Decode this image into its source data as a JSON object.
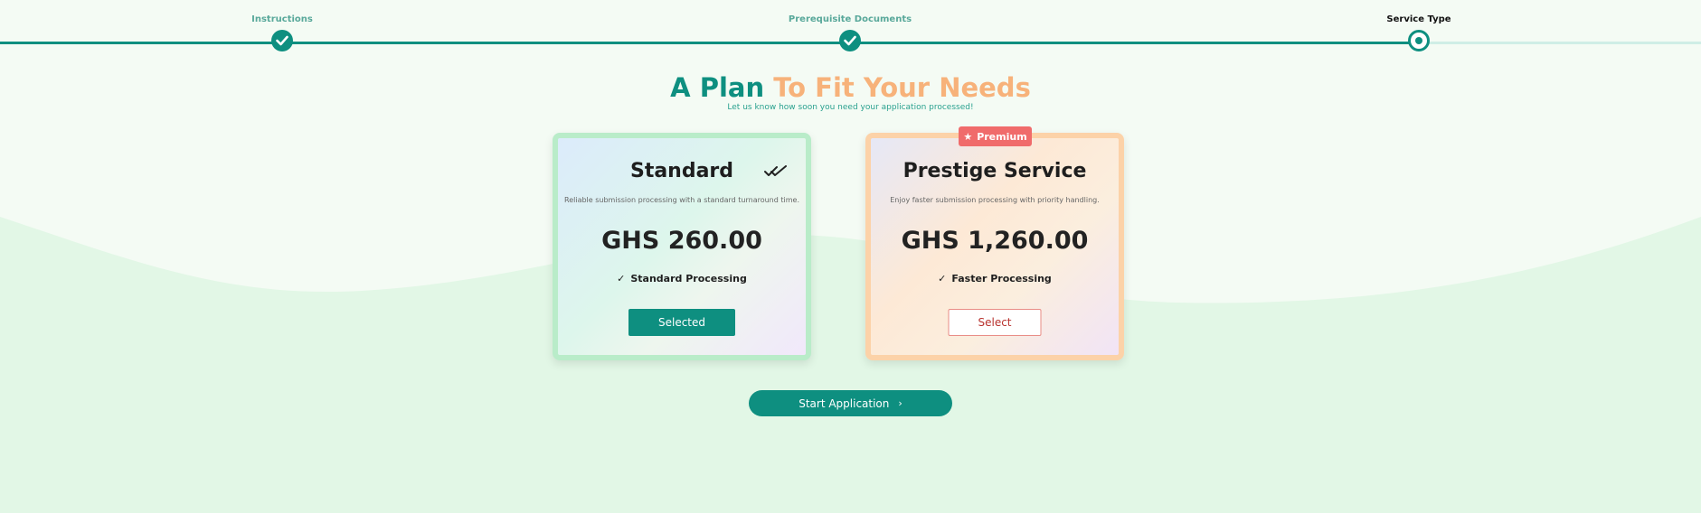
{
  "stepper": {
    "steps": [
      {
        "label": "Instructions",
        "status": "completed"
      },
      {
        "label": "Prerequisite Documents",
        "status": "completed"
      },
      {
        "label": "Service Type",
        "status": "current"
      }
    ]
  },
  "heading": {
    "title_part1": "A Plan",
    "title_part2": "To Fit Your Needs",
    "subtitle": "Let us know how soon you need your application processed!"
  },
  "plans": [
    {
      "name": "Standard",
      "description": "Reliable submission processing with a standard turnaround time.",
      "price": "GHS 260.00",
      "feature": "Standard Processing",
      "button": "Selected",
      "selected": true,
      "check_icon": "double-check-icon"
    },
    {
      "name": "Prestige Service",
      "description": "Enjoy faster submission processing with priority handling.",
      "price": "GHS 1,260.00",
      "feature": "Faster Processing",
      "button": "Select",
      "selected": false,
      "badge": "Premium",
      "badge_icon": "star-icon"
    }
  ],
  "feature_tick": "✓",
  "start_button": {
    "label": "Start Application",
    "icon": "chevron-right-icon",
    "arrow": "›"
  },
  "colors": {
    "accent": "#0e8f80",
    "title_highlight": "#f7b27a",
    "badge": "#f06b6b",
    "select_text": "#b8322e",
    "background": "#f4fbf4",
    "wave": "#e2f7e6"
  }
}
